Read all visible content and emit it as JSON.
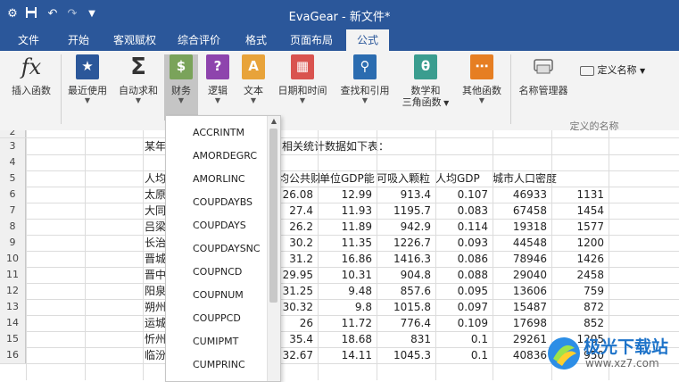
{
  "window": {
    "title": "EvaGear - 新文件*"
  },
  "quick_access": {
    "icons": [
      "gear-icon",
      "save-icon",
      "undo-icon",
      "redo-icon",
      "customize-dropdown-icon"
    ]
  },
  "tabs": [
    "文件",
    "开始",
    "客观赋权",
    "综合评价",
    "格式",
    "页面布局",
    "公式"
  ],
  "active_tab": "公式",
  "ribbon": {
    "buttons": [
      {
        "label": "插入函数",
        "icon": "fx-icon"
      },
      {
        "label": "最近使用",
        "icon": "star-icon"
      },
      {
        "label": "自动求和",
        "icon": "sigma-icon"
      },
      {
        "label": "财务",
        "icon": "coins-icon"
      },
      {
        "label": "逻辑",
        "icon": "question-book-icon"
      },
      {
        "label": "文本",
        "icon": "text-book-icon"
      },
      {
        "label": "日期和时间",
        "icon": "calendar-icon"
      },
      {
        "label": "查找和引用",
        "icon": "magnifier-book-icon"
      },
      {
        "label": "数学和三角函数",
        "icon": "theta-book-icon",
        "line1": "数学和",
        "line2": "三角函数"
      },
      {
        "label": "其他函数",
        "icon": "dots-book-icon"
      },
      {
        "label": "名称管理器",
        "icon": "name-manager-icon"
      }
    ],
    "define_name": "定义名称",
    "group_label": "定义的名称",
    "colors": {
      "star": "#2b579a",
      "coins": "#7aa35a",
      "logic": "#8e44ad",
      "text": "#e8a33a",
      "date": "#d9534f",
      "lookup": "#2b6cb0",
      "math": "#3a9d8f",
      "other": "#e67e22"
    }
  },
  "finance_menu": {
    "items": [
      "ACCRINTM",
      "AMORDEGRC",
      "AMORLINC",
      "COUPDAYBS",
      "COUPDAYS",
      "COUPDAYSNC",
      "COUPNCD",
      "COUPNUM",
      "COUPPCD",
      "CUMIPMT",
      "CUMPRINC"
    ]
  },
  "sheet": {
    "rows": [
      {
        "n": "2",
        "cells": []
      },
      {
        "n": "3",
        "cells": [
          "某年",
          "相关统计数据如下表："
        ]
      },
      {
        "n": "4",
        "cells": []
      },
      {
        "n": "5",
        "cells": [
          "人均",
          "均公共财",
          "单位GDP能",
          "可吸入颗粒",
          "人均GDP",
          "城市人口密度"
        ]
      },
      {
        "n": "6",
        "cells": [
          "太原",
          "26.08",
          "12.99",
          "913.4",
          "0.107",
          "46933",
          "1131"
        ]
      },
      {
        "n": "7",
        "cells": [
          "大同",
          "27.4",
          "11.93",
          "1195.7",
          "0.083",
          "67458",
          "1454"
        ]
      },
      {
        "n": "8",
        "cells": [
          "吕梁",
          "26.2",
          "11.89",
          "942.9",
          "0.114",
          "19318",
          "1577"
        ]
      },
      {
        "n": "9",
        "cells": [
          "长治",
          "30.2",
          "11.35",
          "1226.7",
          "0.093",
          "44548",
          "1200"
        ]
      },
      {
        "n": "10",
        "cells": [
          "晋城",
          "31.2",
          "16.86",
          "1416.3",
          "0.086",
          "78946",
          "1426"
        ]
      },
      {
        "n": "11",
        "cells": [
          "晋中",
          "29.95",
          "10.31",
          "904.8",
          "0.088",
          "29040",
          "2458"
        ]
      },
      {
        "n": "12",
        "cells": [
          "阳泉",
          "31.25",
          "9.48",
          "857.6",
          "0.095",
          "13606",
          "759"
        ]
      },
      {
        "n": "13",
        "cells": [
          "朔州",
          "30.32",
          "9.8",
          "1015.8",
          "0.097",
          "15487",
          "872"
        ]
      },
      {
        "n": "14",
        "cells": [
          "运城",
          "26",
          "11.72",
          "776.4",
          "0.109",
          "17698",
          "852"
        ]
      },
      {
        "n": "15",
        "cells": [
          "忻州",
          "35.4",
          "18.68",
          "831",
          "0.1",
          "29261",
          "1205"
        ]
      },
      {
        "n": "16",
        "cells": [
          "临汾",
          "32.67",
          "14.11",
          "1045.3",
          "0.1",
          "40836",
          "950"
        ]
      }
    ]
  },
  "watermark": {
    "text": "极光下载站",
    "url": "www.xz7.com"
  }
}
